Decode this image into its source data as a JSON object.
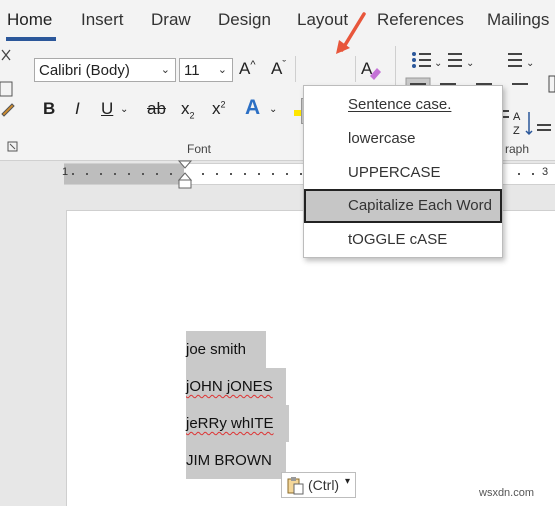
{
  "tabs": [
    "Home",
    "Insert",
    "Draw",
    "Design",
    "Layout",
    "References",
    "Mailings"
  ],
  "font": {
    "name": "Calibri (Body)",
    "size": "11",
    "group_label": "Font",
    "grow_label": "A",
    "shrink_label": "A",
    "bold": "B",
    "italic": "I",
    "underline": "U",
    "strike": "ab",
    "subscript": "x",
    "superscript": "x",
    "effects": "A",
    "change_case": "Aa"
  },
  "paragraph": {
    "group_label": "raph"
  },
  "ruler": {
    "start": "1",
    "end": "3"
  },
  "menu": {
    "items": [
      {
        "label": "Sentence case."
      },
      {
        "label": "lowercase"
      },
      {
        "label": "UPPERCASE"
      },
      {
        "label": "Capitalize Each Word"
      },
      {
        "label": "tOGGLE cASE"
      }
    ],
    "highlighted_index": 3
  },
  "document": {
    "lines": [
      "joe smith",
      "jOHN jONES",
      "jeRRy whITE",
      "JIM BROWN"
    ]
  },
  "paste_options": {
    "label": "(Ctrl)"
  },
  "watermark": "wsxdn.com",
  "colors": {
    "accent": "#2b579a",
    "arrow": "#e8563b",
    "selection": "#c9c9c9"
  }
}
